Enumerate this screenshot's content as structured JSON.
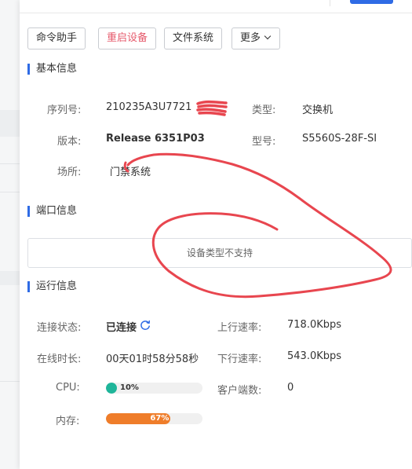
{
  "toolbar": {
    "buttons": [
      "命令助手",
      "重启设备",
      "文件系统",
      "更多"
    ]
  },
  "basic_info": {
    "title": "基本信息",
    "serial_label": "序列号:",
    "serial_value": "210235A3U7721",
    "type_label": "类型:",
    "type_value": "交换机",
    "version_label": "版本:",
    "version_value": "Release 6351P03",
    "model_label": "型号:",
    "model_value": "S5560S-28F-SI",
    "location_label": "场所:",
    "location_value": "门禁系统"
  },
  "port_info": {
    "title": "端口信息",
    "message": "设备类型不支持"
  },
  "run_info": {
    "title": "运行信息",
    "conn_label": "连接状态:",
    "conn_value": "已连接",
    "upload_label": "上行速率:",
    "upload_value": "718.0Kbps",
    "online_label": "在线时长:",
    "online_value": "00天01时58分58秒",
    "download_label": "下行速率:",
    "download_value": "543.0Kbps",
    "cpu_label": "CPU:",
    "cpu_percent": 10,
    "cpu_text": "10%",
    "clients_label": "客户端数:",
    "clients_value": "0",
    "mem_label": "内存:",
    "mem_percent": 67,
    "mem_text": "67%"
  },
  "colors": {
    "accent": "#2f6be5",
    "danger": "#e65a6c",
    "cpu_bar": "#1fb59a",
    "mem_bar": "#ef7d2a",
    "annotation": "#e8464f"
  },
  "icons": {
    "refresh": "refresh-icon",
    "more": "chevron-down-icon"
  }
}
